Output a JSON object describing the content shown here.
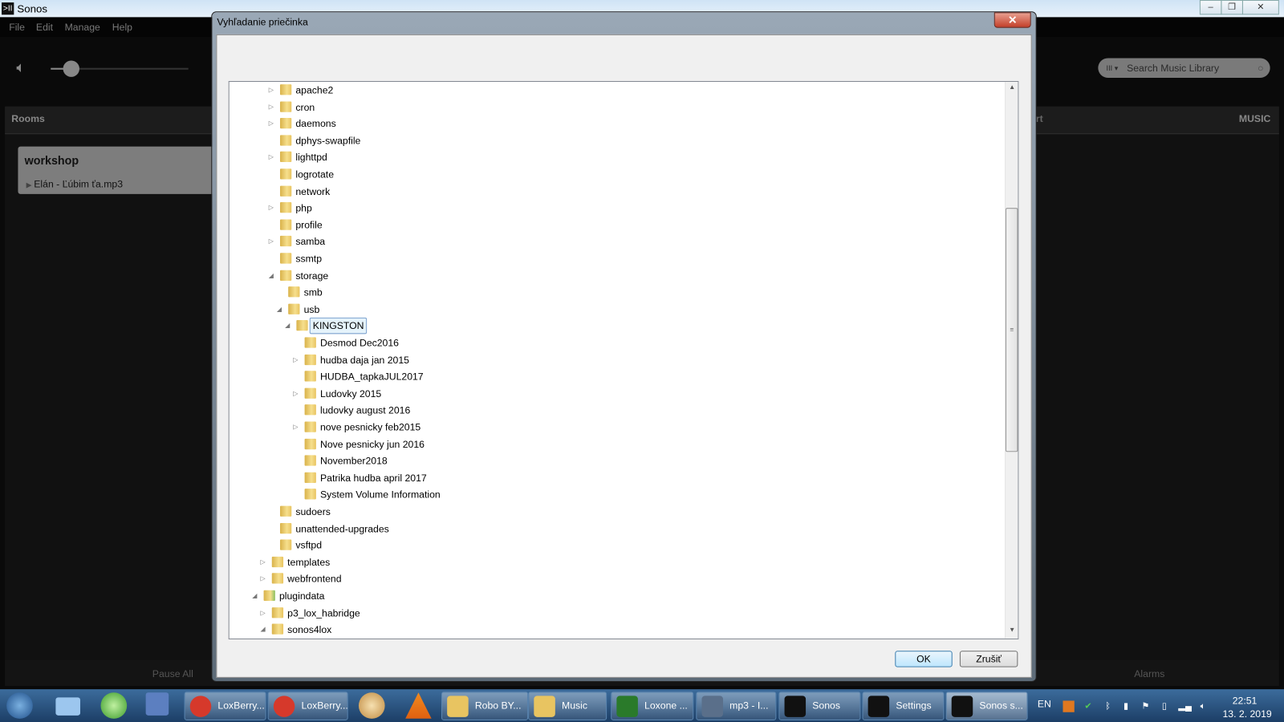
{
  "app": {
    "title": "Sonos",
    "menu": [
      "File",
      "Edit",
      "Manage",
      "Help"
    ],
    "search_placeholder": "Search Music Library",
    "rooms_label": "Rooms",
    "music_label": "MUSIC",
    "art_partial": "rt",
    "room": {
      "name": "workshop",
      "track": "Elán - Ľúbim ťa.mp3"
    },
    "pause_all": "Pause All",
    "alarms": "Alarms",
    "volume_percent": 15
  },
  "dialog": {
    "title": "Vyhľadanie priečinka",
    "close": "✕",
    "ok": "OK",
    "cancel": "Zrušiť",
    "tree": [
      {
        "label": "apache2",
        "level": 2,
        "exp": "collapsed"
      },
      {
        "label": "cron",
        "level": 2,
        "exp": "collapsed"
      },
      {
        "label": "daemons",
        "level": 2,
        "exp": "collapsed"
      },
      {
        "label": "dphys-swapfile",
        "level": 2,
        "exp": "none"
      },
      {
        "label": "lighttpd",
        "level": 2,
        "exp": "collapsed"
      },
      {
        "label": "logrotate",
        "level": 2,
        "exp": "none"
      },
      {
        "label": "network",
        "level": 2,
        "exp": "none"
      },
      {
        "label": "php",
        "level": 2,
        "exp": "collapsed"
      },
      {
        "label": "profile",
        "level": 2,
        "exp": "none"
      },
      {
        "label": "samba",
        "level": 2,
        "exp": "collapsed"
      },
      {
        "label": "ssmtp",
        "level": 2,
        "exp": "none"
      },
      {
        "label": "storage",
        "level": 2,
        "exp": "expanded"
      },
      {
        "label": "smb",
        "level": 3,
        "exp": "none"
      },
      {
        "label": "usb",
        "level": 3,
        "exp": "expanded"
      },
      {
        "label": "KINGSTON",
        "level": 4,
        "exp": "expanded",
        "selected": true
      },
      {
        "label": "Desmod Dec2016",
        "level": 5,
        "exp": "none"
      },
      {
        "label": "hudba daja jan 2015",
        "level": 5,
        "exp": "collapsed"
      },
      {
        "label": "HUDBA_tapkaJUL2017",
        "level": 5,
        "exp": "none"
      },
      {
        "label": "Ludovky 2015",
        "level": 5,
        "exp": "collapsed"
      },
      {
        "label": "ludovky august 2016",
        "level": 5,
        "exp": "none"
      },
      {
        "label": "nove pesnicky feb2015",
        "level": 5,
        "exp": "collapsed"
      },
      {
        "label": "Nove pesnicky jun 2016",
        "level": 5,
        "exp": "none"
      },
      {
        "label": "November2018",
        "level": 5,
        "exp": "none"
      },
      {
        "label": "Patrika hudba april 2017",
        "level": 5,
        "exp": "none"
      },
      {
        "label": "System Volume Information",
        "level": 5,
        "exp": "none"
      },
      {
        "label": "sudoers",
        "level": 2,
        "exp": "none"
      },
      {
        "label": "unattended-upgrades",
        "level": 2,
        "exp": "none"
      },
      {
        "label": "vsftpd",
        "level": 2,
        "exp": "none"
      },
      {
        "label": "templates",
        "level": 1,
        "exp": "collapsed"
      },
      {
        "label": "webfrontend",
        "level": 1,
        "exp": "collapsed"
      },
      {
        "label": "plugindata",
        "level": 0,
        "exp": "expanded",
        "icon": "user-folder"
      },
      {
        "label": "p3_lox_habridge",
        "level": 1,
        "exp": "collapsed"
      },
      {
        "label": "sonos4lox",
        "level": 1,
        "exp": "expanded"
      }
    ]
  },
  "taskbar": {
    "buttons": [
      {
        "label": "LoxBerry...",
        "icon": "chrome-icon",
        "color": "#d6392b"
      },
      {
        "label": "LoxBerry...",
        "icon": "chrome-icon",
        "color": "#d6392b"
      },
      {
        "label": "Robo BY...",
        "icon": "folder-icon",
        "color": "#e8c461"
      },
      {
        "label": "Music",
        "icon": "folder-icon",
        "color": "#e8c461"
      },
      {
        "label": "Loxone ...",
        "icon": "loxone-icon",
        "color": "#2a7a2a"
      },
      {
        "label": "mp3 - I...",
        "icon": "lock-icon",
        "color": "#5a6f8a"
      },
      {
        "label": "Sonos",
        "icon": "sonos-icon",
        "color": "#111"
      },
      {
        "label": "Settings",
        "icon": "sonos-icon",
        "color": "#111"
      },
      {
        "label": "Sonos s...",
        "icon": "sonos-icon",
        "color": "#111"
      }
    ],
    "lang": "EN",
    "time": "22:51",
    "date": "13. 2. 2019"
  }
}
